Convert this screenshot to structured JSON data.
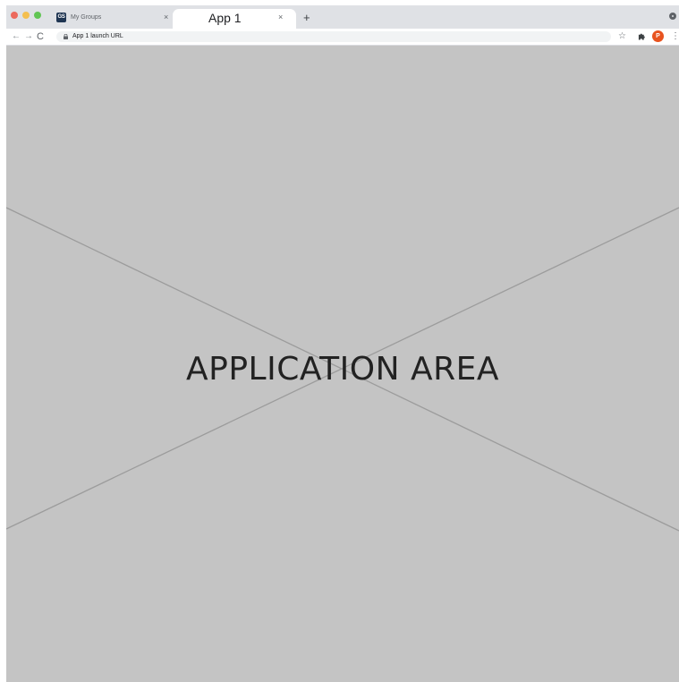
{
  "browser": {
    "tabs": [
      {
        "title": "My Groups",
        "favicon_text": "GS",
        "active": false,
        "close_glyph": "×"
      },
      {
        "title": "App 1",
        "active": true,
        "close_glyph": "×"
      }
    ],
    "new_tab_glyph": "+",
    "toolbar": {
      "back_glyph": "←",
      "forward_glyph": "→",
      "reload_glyph": "C",
      "url": "App 1 launch URL",
      "bookmark_glyph": "☆",
      "menu_glyph": "⋮",
      "profile_initial": "P"
    },
    "icons": [
      "close-window-icon",
      "minimize-icon",
      "maximize-icon",
      "lock-icon",
      "star-icon",
      "puzzle-icon",
      "profile-avatar",
      "kebab-menu-icon"
    ]
  },
  "app": {
    "placeholder_label": "APPLICATION AREA"
  },
  "colors": {
    "tabstrip_bg": "#dfe1e5",
    "app_area_bg": "#c4c4c4",
    "avatar_bg": "#e8531f",
    "traffic_red": "#ec6a5e",
    "traffic_yellow": "#f4bf4f",
    "traffic_green": "#61c554"
  }
}
